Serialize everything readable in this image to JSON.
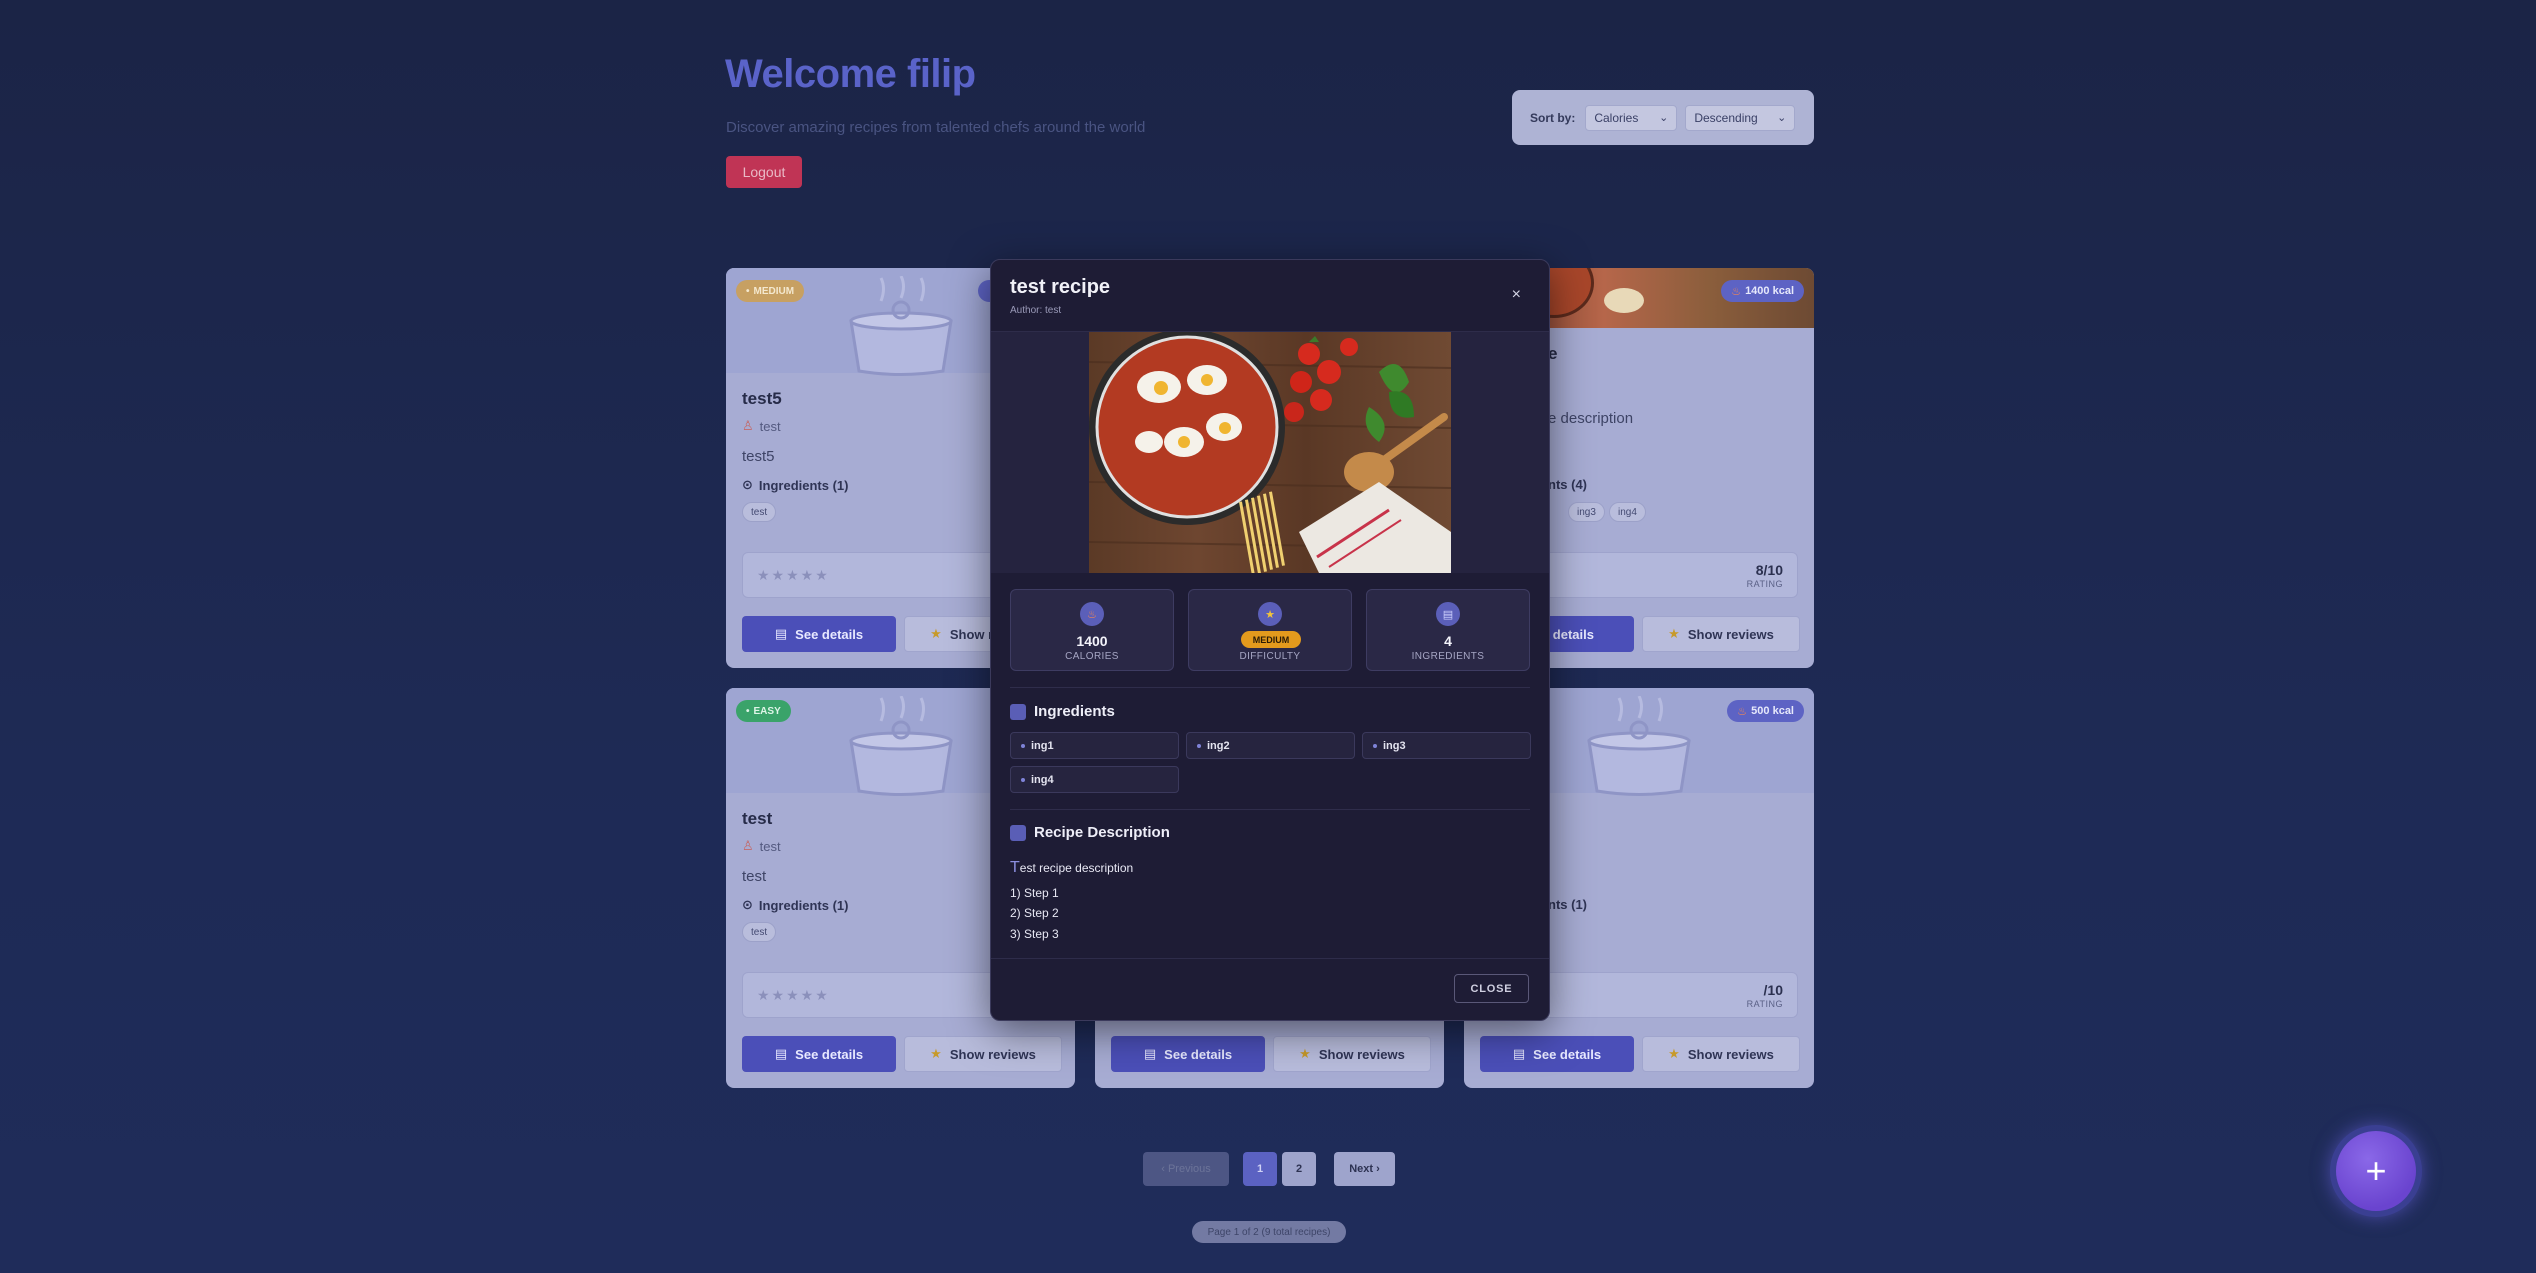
{
  "header": {
    "welcome": "Welcome filip",
    "subtitle": "Discover amazing recipes from talented chefs around the world",
    "logout_label": "Logout"
  },
  "sort": {
    "label": "Sort by:",
    "field_value": "Calories",
    "order_value": "Descending"
  },
  "cards": [
    {
      "difficulty": "MEDIUM",
      "title": "test5",
      "author": "test",
      "description": "test5",
      "ingredients_label": "Ingredients (1)",
      "ingredients": [
        "test"
      ],
      "stars": "★★★★★",
      "details_label": "See details",
      "reviews_label": "Show reviews"
    },
    {
      "kcal": "1400 kcal",
      "title_fragment": "e",
      "description_fragment": "e description",
      "ingredients_label_fragment": "nts (4)",
      "chips": [
        "ing3",
        "ing4"
      ],
      "rating": "8/10",
      "rating_label": "RATING",
      "details_label_fragment": "e details",
      "reviews_label": "Show reviews"
    },
    {
      "difficulty": "EASY",
      "title": "test",
      "author": "test",
      "description": "test",
      "ingredients_label": "Ingredients (1)",
      "ingredients": [
        "test"
      ],
      "stars": "★★★★★",
      "details_label": "See details",
      "reviews_label": "Show reviews"
    },
    {
      "details_label": "See details",
      "reviews_label": "Show reviews"
    },
    {
      "kcal": "500 kcal",
      "ingredients_label_fragment": "nts (1)",
      "rating": "/10",
      "rating_label": "RATING",
      "details_label": "See details",
      "reviews_label": "Show reviews"
    }
  ],
  "pagination": {
    "previous_label": "‹ Previous",
    "pages": [
      "1",
      "2"
    ],
    "next_label": "Next ›",
    "info": "Page 1 of 2 (9 total recipes)"
  },
  "fab": {
    "label": "+"
  },
  "modal": {
    "title": "test recipe",
    "author": "Author: test",
    "close_x": "×",
    "stats": {
      "calories": {
        "value": "1400",
        "label": "CALORIES"
      },
      "difficulty": {
        "value": "MEDIUM",
        "label": "DIFFICULTY"
      },
      "ingredients": {
        "value": "4",
        "label": "INGREDIENTS"
      }
    },
    "ingredients_title": "Ingredients",
    "ingredients": [
      "ing1",
      "ing2",
      "ing3",
      "ing4"
    ],
    "description_title": "Recipe Description",
    "description_cap": "T",
    "description_rest": "est recipe description",
    "steps": [
      "1) Step 1",
      "2) Step 2",
      "3) Step 3"
    ],
    "close_label": "CLOSE"
  },
  "colors": {
    "background": "#1e2a55",
    "accent": "#5a63c9",
    "logout": "#c03455",
    "medium_badge": "#e39a1d",
    "easy_badge": "#3aa36a",
    "modal_bg": "#1e1c35"
  }
}
